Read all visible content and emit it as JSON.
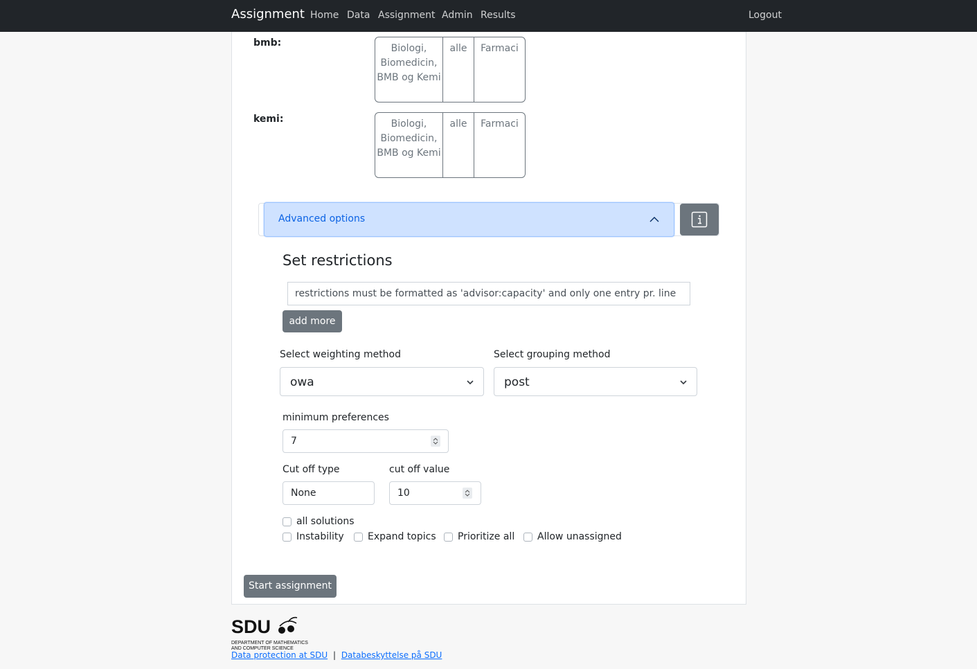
{
  "navbar": {
    "brand": "Assignment",
    "links": [
      "Home",
      "Data",
      "Assignment",
      "Admin",
      "Results"
    ],
    "logout": "Logout"
  },
  "programs": [
    {
      "label": "bmb:",
      "cells": [
        "Biologi, Biomedicin, BMB og Kemi",
        "alle",
        "Farmaci"
      ]
    },
    {
      "label": "kemi:",
      "cells": [
        "Biologi, Biomedicin, BMB og Kemi",
        "alle",
        "Farmaci"
      ]
    }
  ],
  "advanced": {
    "title": "Advanced options",
    "info_icon": "info-icon",
    "restrictions_heading": "Set restrictions",
    "restrictions_text": "restrictions must be formatted as 'advisor:capacity' and only one entry pr. line",
    "add_more": "add more",
    "weighting_label": "Select weighting method",
    "weighting_value": "owa",
    "grouping_label": "Select grouping method",
    "grouping_value": "post",
    "min_pref_label": "minimum preferences",
    "min_pref_value": "7",
    "cutoff_type_label": "Cut off type",
    "cutoff_type_value": "None",
    "cutoff_value_label": "cut off value",
    "cutoff_value": "10",
    "checkboxes": {
      "all_solutions": "all solutions",
      "instability": "Instability",
      "expand_topics": "Expand topics",
      "prioritize_all": "Prioritize all",
      "allow_unassigned": "Allow unassigned"
    }
  },
  "start_button": "Start assignment",
  "footer": {
    "logo_text": "SDU",
    "logo_sub1": "DEPARTMENT OF MATHEMATICS",
    "logo_sub2": "AND COMPUTER SCIENCE",
    "link1": "Data protection at SDU",
    "separator": "|",
    "link2": "Databeskyttelse på SDU"
  },
  "colors": {
    "navbar": "#212529",
    "accordion_active": "#cfe2ff",
    "accordion_text": "#0c63e4",
    "secondary_button": "#6c757d",
    "link": "#0d6efd"
  }
}
